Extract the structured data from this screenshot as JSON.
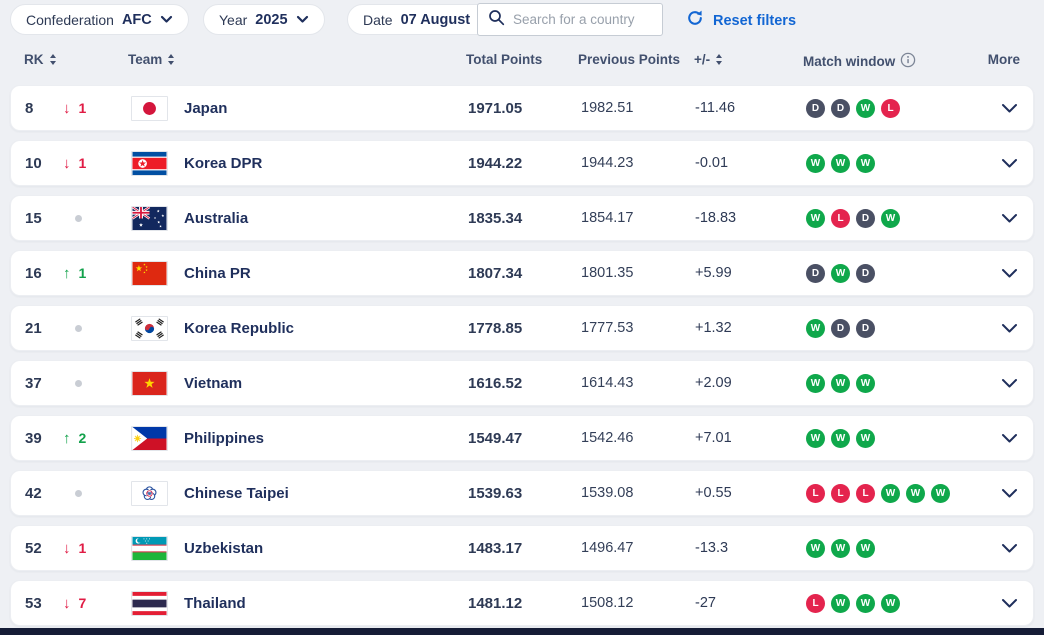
{
  "filters": {
    "confederation": {
      "label": "Confederation",
      "value": "AFC"
    },
    "year": {
      "label": "Year",
      "value": "2025"
    },
    "date": {
      "label": "Date",
      "value": "07 August"
    },
    "search_placeholder": "Search for a country",
    "reset_label": "Reset filters"
  },
  "colors": {
    "accent_blue": "#1266d3",
    "navy_text": "#1f2f5c",
    "win_green": "#0fa84b",
    "draw_slate": "#4a5064",
    "loss_red": "#e4244e",
    "movement_down_red": "#e01b44",
    "movement_up_green": "#12a14b",
    "page_background": "#eef0f4"
  },
  "table": {
    "headers": {
      "rk": "RK",
      "team": "Team",
      "total_points": "Total Points",
      "previous_points": "Previous Points",
      "plus_minus": "+/-",
      "match_window": "Match window",
      "more": "More"
    },
    "rows": [
      {
        "rank": "8",
        "movement": "down",
        "movement_value": "1",
        "team": "Japan",
        "flag": "japan",
        "total": "1971.05",
        "previous": "1982.51",
        "change": "-11.46",
        "results": [
          "D",
          "D",
          "W",
          "L"
        ]
      },
      {
        "rank": "10",
        "movement": "down",
        "movement_value": "1",
        "team": "Korea DPR",
        "flag": "korea-dpr",
        "total": "1944.22",
        "previous": "1944.23",
        "change": "-0.01",
        "results": [
          "W",
          "W",
          "W"
        ]
      },
      {
        "rank": "15",
        "movement": "none",
        "movement_value": "",
        "team": "Australia",
        "flag": "australia",
        "total": "1835.34",
        "previous": "1854.17",
        "change": "-18.83",
        "results": [
          "W",
          "L",
          "D",
          "W"
        ]
      },
      {
        "rank": "16",
        "movement": "up",
        "movement_value": "1",
        "team": "China PR",
        "flag": "china",
        "total": "1807.34",
        "previous": "1801.35",
        "change": "+5.99",
        "results": [
          "D",
          "W",
          "D"
        ]
      },
      {
        "rank": "21",
        "movement": "none",
        "movement_value": "",
        "team": "Korea Republic",
        "flag": "korea-republic",
        "total": "1778.85",
        "previous": "1777.53",
        "change": "+1.32",
        "results": [
          "W",
          "D",
          "D"
        ]
      },
      {
        "rank": "37",
        "movement": "none",
        "movement_value": "",
        "team": "Vietnam",
        "flag": "vietnam",
        "total": "1616.52",
        "previous": "1614.43",
        "change": "+2.09",
        "results": [
          "W",
          "W",
          "W"
        ]
      },
      {
        "rank": "39",
        "movement": "up",
        "movement_value": "2",
        "team": "Philippines",
        "flag": "philippines",
        "total": "1549.47",
        "previous": "1542.46",
        "change": "+7.01",
        "results": [
          "W",
          "W",
          "W"
        ]
      },
      {
        "rank": "42",
        "movement": "none",
        "movement_value": "",
        "team": "Chinese Taipei",
        "flag": "chinese-taipei",
        "total": "1539.63",
        "previous": "1539.08",
        "change": "+0.55",
        "results": [
          "L",
          "L",
          "L",
          "W",
          "W",
          "W"
        ]
      },
      {
        "rank": "52",
        "movement": "down",
        "movement_value": "1",
        "team": "Uzbekistan",
        "flag": "uzbekistan",
        "total": "1483.17",
        "previous": "1496.47",
        "change": "-13.3",
        "results": [
          "W",
          "W",
          "W"
        ]
      },
      {
        "rank": "53",
        "movement": "down",
        "movement_value": "7",
        "team": "Thailand",
        "flag": "thailand",
        "total": "1481.12",
        "previous": "1508.12",
        "change": "-27",
        "results": [
          "L",
          "W",
          "W",
          "W"
        ]
      }
    ]
  }
}
